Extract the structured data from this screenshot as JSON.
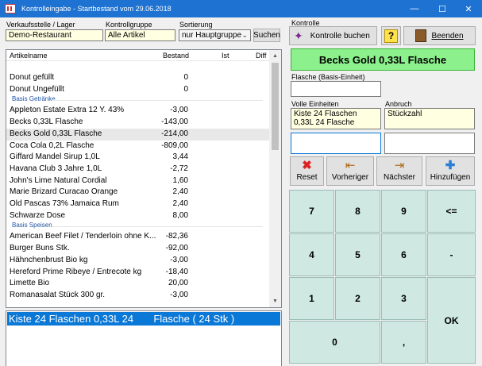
{
  "window": {
    "title": "Kontrolleingabe - Startbestand vom 29.06.2018",
    "minimize": "—",
    "maximize": "☐",
    "close": "✕"
  },
  "filters": {
    "verkaufsstelle_label": "Verkaufsstelle / Lager",
    "verkaufsstelle_value": "Demo-Restaurant",
    "kontrollgruppe_label": "Kontrollgruppe",
    "kontrollgruppe_value": "Alle Artikel",
    "sortierung_label": "Sortierung",
    "sortierung_value": "nur Hauptgruppe",
    "suchen_label": "Suchen"
  },
  "list": {
    "headers": {
      "artikelname": "Artikelname",
      "bestand": "Bestand",
      "ist": "Ist",
      "diff": "Diff"
    },
    "rows": [
      {
        "type": "item",
        "name": "Donut gefüllt",
        "bestand": "0"
      },
      {
        "type": "item",
        "name": "Donut Ungefüllt",
        "bestand": "0"
      },
      {
        "type": "group",
        "name": "Basis Getränke"
      },
      {
        "type": "item",
        "name": "Appleton Estate Extra 12 Y. 43%",
        "bestand": "-3,00"
      },
      {
        "type": "item",
        "name": "Becks 0,33L Flasche",
        "bestand": "-143,00"
      },
      {
        "type": "item",
        "name": "Becks Gold 0,33L Flasche",
        "bestand": "-214,00",
        "selected": true
      },
      {
        "type": "item",
        "name": "Coca Cola 0,2L Flasche",
        "bestand": "-809,00"
      },
      {
        "type": "item",
        "name": "Giffard Mandel Sirup 1,0L",
        "bestand": "3,44"
      },
      {
        "type": "item",
        "name": "Havana Club 3 Jahre 1,0L",
        "bestand": "-2,72"
      },
      {
        "type": "item",
        "name": "John's Lime Natural Cordial",
        "bestand": "1,60"
      },
      {
        "type": "item",
        "name": "Marie Brizard Curacao Orange",
        "bestand": "2,40"
      },
      {
        "type": "item",
        "name": "Old Pascas 73% Jamaica Rum",
        "bestand": "2,40"
      },
      {
        "type": "item",
        "name": "Schwarze Dose",
        "bestand": "8,00"
      },
      {
        "type": "group",
        "name": "Basis Speisen"
      },
      {
        "type": "item",
        "name": "American Beef Filet / Tenderloin ohne K...",
        "bestand": "-82,36"
      },
      {
        "type": "item",
        "name": "Burger Buns Stk.",
        "bestand": "-92,00"
      },
      {
        "type": "item",
        "name": "Hähnchenbrust Bio kg",
        "bestand": "-3,00"
      },
      {
        "type": "item",
        "name": "Hereford Prime Ribeye / Entrecote kg",
        "bestand": "-18,40"
      },
      {
        "type": "item",
        "name": "Limette Bio",
        "bestand": "20,00"
      },
      {
        "type": "item",
        "name": "Romanasalat Stück 300 gr.",
        "bestand": "-3,00"
      }
    ]
  },
  "detail": {
    "selected_line": "Kiste 24 Flaschen 0,33L 24       Flasche ( 24 Stk )"
  },
  "kontrolle": {
    "section_label": "Kontrolle",
    "buchen_label": "Kontrolle buchen",
    "help_label": "?",
    "beenden_label": "Beenden",
    "product_name": "Becks Gold 0,33L Flasche",
    "flasche_label": "Flasche (Basis-Einheit)",
    "flasche_value": "",
    "volle_label": "Volle Einheiten",
    "volle_value": "Kiste 24 Flaschen 0,33L 24 Flasche",
    "anbruch_label": "Anbruch",
    "anbruch_value": "Stückzahl",
    "volle_input": "",
    "anbruch_input": ""
  },
  "actions": {
    "reset": "Reset",
    "vorheriger": "Vorheriger",
    "naechster": "Nächster",
    "hinzufuegen": "Hinzufügen"
  },
  "keypad": {
    "k7": "7",
    "k8": "8",
    "k9": "9",
    "back": "<=",
    "k4": "4",
    "k5": "5",
    "k6": "6",
    "minus": "-",
    "k1": "1",
    "k2": "2",
    "k3": "3",
    "ok": "OK",
    "k0": "0",
    "comma": ","
  },
  "icons": {
    "app": "register-icon",
    "buchen": "wand-icon",
    "help": "help-icon",
    "beenden": "exit-door-icon",
    "reset": "red-x-icon",
    "vorheriger": "previous-icon",
    "naechster": "next-icon",
    "hinzufuegen": "plus-icon"
  },
  "colors": {
    "titlebar": "#1e72d1",
    "product_bg": "#8cf08c",
    "keypad_bg": "#cfe8e2",
    "selection": "#0a78d7",
    "input_yellow": "#ffffe1"
  }
}
